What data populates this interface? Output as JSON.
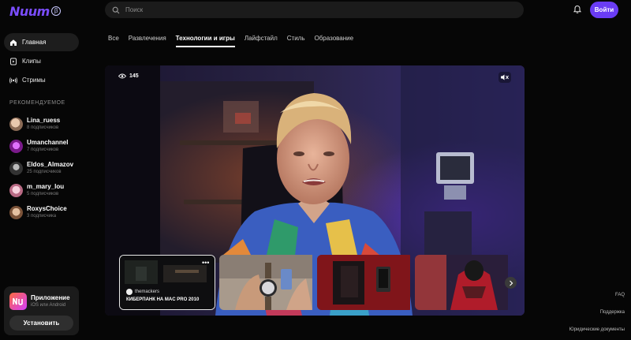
{
  "logo": {
    "text": "Nuum",
    "badge": "β"
  },
  "search": {
    "placeholder": "Поиск"
  },
  "header": {
    "login_label": "Войти"
  },
  "nav": [
    {
      "label": "Главная",
      "icon": "home-icon",
      "active": true
    },
    {
      "label": "Клипы",
      "icon": "clips-icon",
      "active": false
    },
    {
      "label": "Стримы",
      "icon": "streams-icon",
      "active": false
    }
  ],
  "recommended": {
    "title": "РЕКОМЕНДУЕМОЕ",
    "items": [
      {
        "name": "Lina_ruess",
        "subs": "8 подписчиков",
        "color": "#c9a48a"
      },
      {
        "name": "Umanchannel",
        "subs": "7 подписчиков",
        "color": "#b13cc8"
      },
      {
        "name": "Eldos_Almazov",
        "subs": "25 подписчиков",
        "color": "#555555"
      },
      {
        "name": "m_mary_lou",
        "subs": "5 подписчиков",
        "color": "#e8b4c2"
      },
      {
        "name": "RoxysChoice",
        "subs": "3 подписчика",
        "color": "#b98a6c"
      }
    ]
  },
  "app": {
    "title": "Приложение",
    "subtitle": "iOS или Android",
    "button": "Установить"
  },
  "tabs": [
    {
      "label": "Все",
      "active": false
    },
    {
      "label": "Развлечения",
      "active": false
    },
    {
      "label": "Технологии и игры",
      "active": true
    },
    {
      "label": "Лайфстайл",
      "active": false
    },
    {
      "label": "Стиль",
      "active": false
    },
    {
      "label": "Образование",
      "active": false
    }
  ],
  "player": {
    "views": "145",
    "featured": {
      "channel": "themackers",
      "title": "КИБЕРПАНК НА MAC PRO 2010"
    }
  },
  "footer": [
    "FAQ",
    "Поддержка",
    "Юридические документы"
  ],
  "colors": {
    "accent": "#6a3cf4",
    "background": "#060606",
    "surface": "#1b1b1b"
  }
}
